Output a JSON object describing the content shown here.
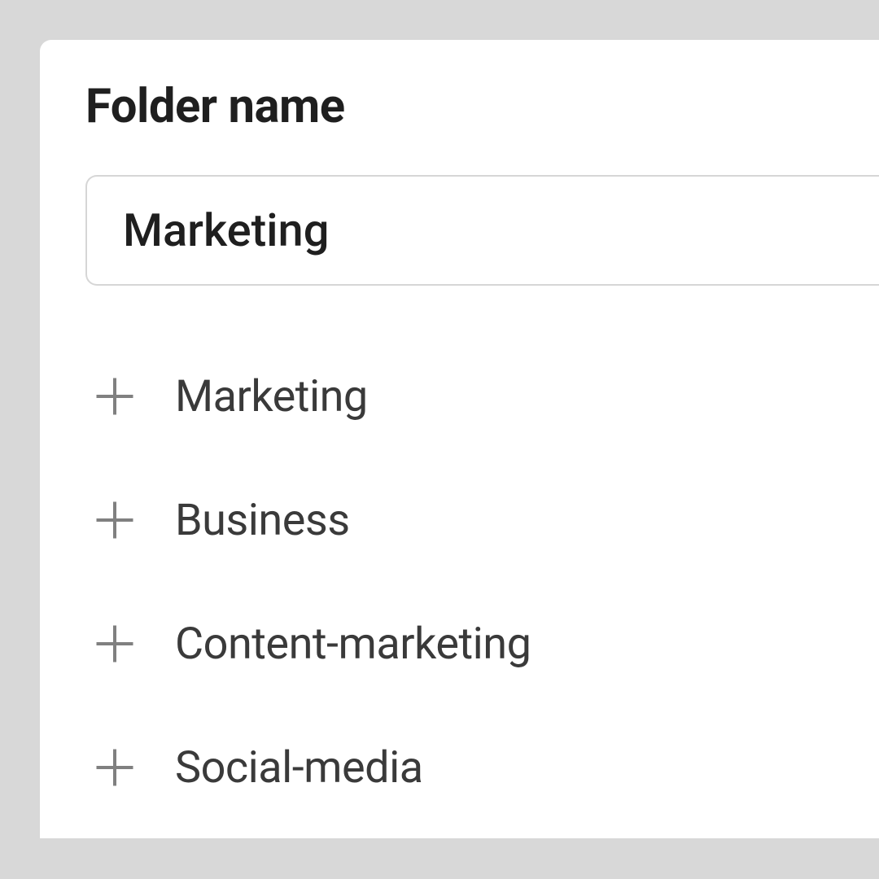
{
  "header": {
    "title": "Folder name"
  },
  "input": {
    "value": "Marketing"
  },
  "suggestions": [
    {
      "label": "Marketing"
    },
    {
      "label": "Business"
    },
    {
      "label": "Content-marketing"
    },
    {
      "label": "Social-media"
    }
  ]
}
